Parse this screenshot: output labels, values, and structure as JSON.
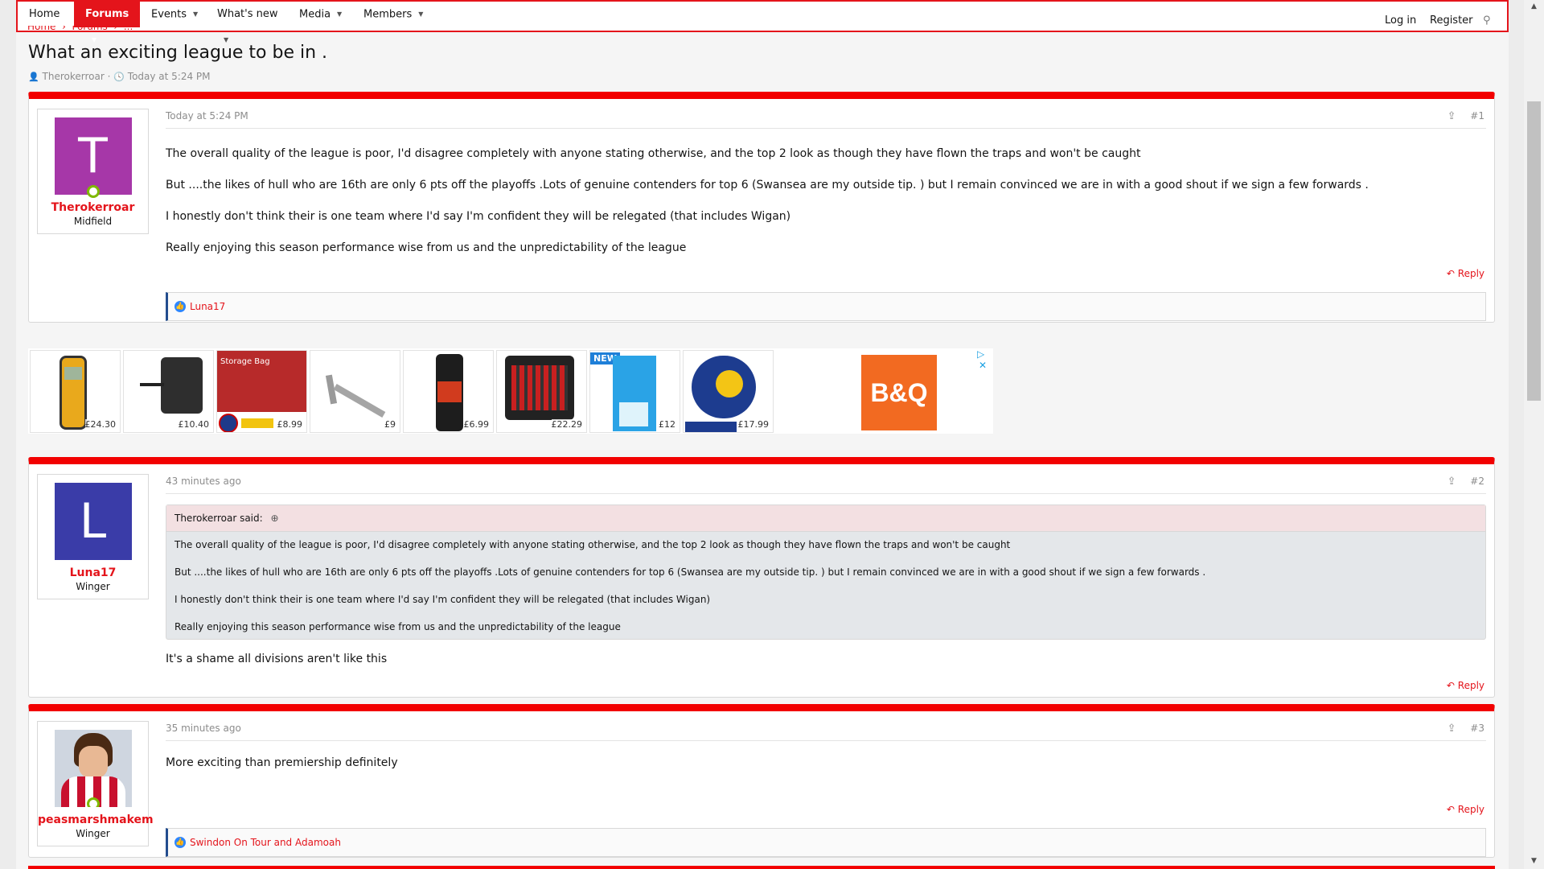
{
  "nav": {
    "items": [
      {
        "label": "Home",
        "active": false,
        "has_menu": false
      },
      {
        "label": "Forums",
        "active": true,
        "has_menu": true
      },
      {
        "label": "Events",
        "active": false,
        "has_menu": true
      },
      {
        "label": "What's new",
        "active": false,
        "has_menu": true
      },
      {
        "label": "Media",
        "active": false,
        "has_menu": true
      },
      {
        "label": "Members",
        "active": false,
        "has_menu": true
      }
    ],
    "login": "Log in",
    "register": "Register"
  },
  "thread": {
    "title": "What an exciting league to be in .",
    "author": "Therokerroar",
    "date": "Today at 5:24 PM"
  },
  "posts": [
    {
      "number": "#1",
      "date": "Today at 5:24 PM",
      "user": {
        "name": "Therokerroar",
        "title": "Midfield",
        "initial": "T",
        "avatar_color": "#a637a8"
      },
      "body": [
        "The overall quality of the league is poor, I'd disagree completely with anyone stating otherwise, and the top 2 look as though they have flown the traps and won't be caught",
        "But ....the likes of hull who are 16th are only 6 pts off the playoffs .Lots of genuine contenders for top 6 (Swansea are my outside tip. ) but I remain convinced we are in with a good shout if we sign a few forwards .",
        "I honestly don't think their is one team where I'd say I'm confident they will be relegated (that includes Wigan)",
        "Really enjoying this season performance wise from us and the unpredictability of the league"
      ],
      "reply": "Reply",
      "reactions": "Luna17"
    },
    {
      "number": "#2",
      "date": "43 minutes ago",
      "user": {
        "name": "Luna17",
        "title": "Winger",
        "initial": "L",
        "avatar_color": "#3a3ca8"
      },
      "quote": {
        "author": "Therokerroar said:",
        "lines": [
          "The overall quality of the league is poor, I'd disagree completely with anyone stating otherwise, and the top 2 look as though they have flown the traps and won't be caught",
          "But ....the likes of hull who are 16th are only 6 pts off the playoffs .Lots of genuine contenders for top 6 (Swansea are my outside tip. ) but I remain convinced we are in with a good shout if we sign a few forwards .",
          "I honestly don't think their is one team where I'd say I'm confident they will be relegated (that includes Wigan)",
          "Really enjoying this season performance wise from us and the unpredictability of the league"
        ]
      },
      "body": [
        "It's a shame all divisions aren't like this"
      ],
      "reply": "Reply"
    },
    {
      "number": "#3",
      "date": "35 minutes ago",
      "user": {
        "name": "peasmarshmakem",
        "title": "Winger"
      },
      "body": [
        "More exciting than premiership definitely"
      ],
      "reply": "Reply",
      "reactions": "Swindon On Tour and Adamoah"
    }
  ],
  "ads": {
    "tiles": [
      {
        "price": "£24.30"
      },
      {
        "price": "£10.40"
      },
      {
        "price": "£8.99",
        "caption": "Storage Bag"
      },
      {
        "price": "£9"
      },
      {
        "price": "£6.99"
      },
      {
        "price": "£22.29"
      },
      {
        "price": "£12",
        "badge": "NEW"
      },
      {
        "price": "£17.99"
      }
    ],
    "brand": "B&Q"
  },
  "colors": {
    "accent": "#e4141b",
    "post_bar": "#f20000"
  }
}
